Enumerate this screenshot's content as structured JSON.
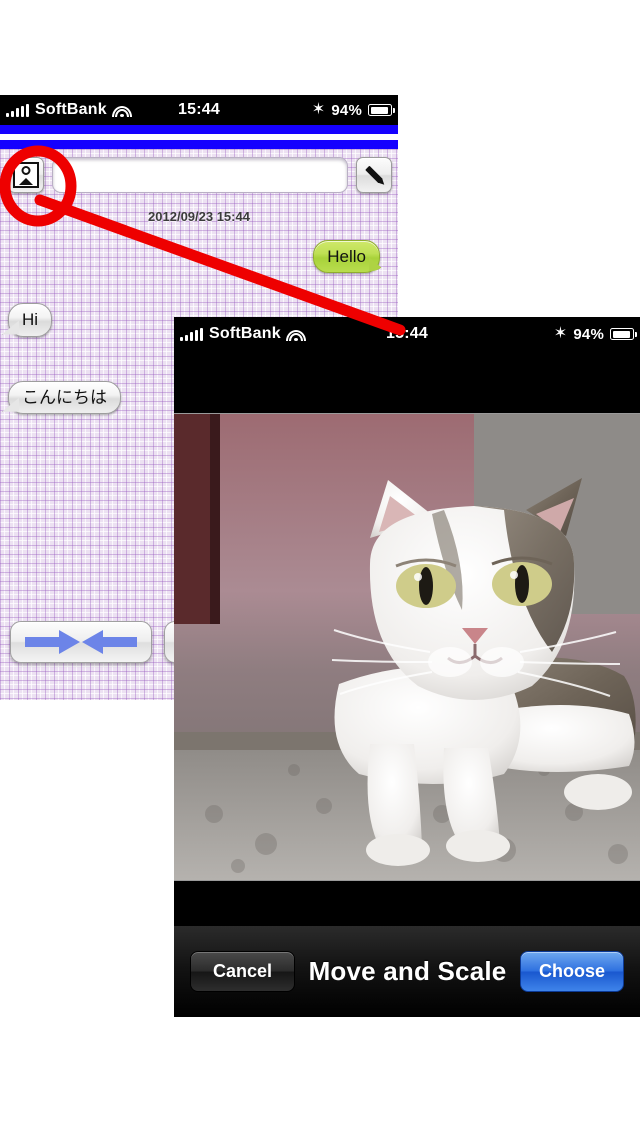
{
  "screen1": {
    "name": "chat-screen",
    "statusbar": {
      "carrier": "SoftBank",
      "time": "15:44",
      "battery_pct": "94%",
      "signal_icon": "signal-bars-icon",
      "wifi_icon": "wifi-icon",
      "bluetooth_icon": "bluetooth-icon",
      "battery_icon": "battery-icon"
    },
    "toolbar": {
      "image_button_icon": "flower-picture-icon",
      "input_value": "",
      "input_placeholder": "",
      "pencil_button_icon": "pencil-icon"
    },
    "datestamp": "2012/09/23 15:44",
    "messages": [
      {
        "text": "Hello",
        "side": "right",
        "style": "green"
      },
      {
        "text": "Hi",
        "side": "left",
        "style": "grey"
      },
      {
        "text": "こんにちは",
        "side": "left",
        "style": "grey"
      }
    ],
    "buttons": [
      {
        "name": "arrow-pair-button",
        "icon": "double-arrow-icon"
      },
      {
        "name": "secondary-button",
        "icon": ""
      }
    ]
  },
  "screen2": {
    "name": "move-and-scale-screen",
    "statusbar": {
      "carrier": "SoftBank",
      "time": "15:44",
      "battery_pct": "94%",
      "signal_icon": "signal-bars-icon",
      "wifi_icon": "wifi-icon",
      "bluetooth_icon": "bluetooth-icon",
      "battery_icon": "battery-icon"
    },
    "photo": {
      "subject": "cat-photo",
      "alt_icon": "photo-preview"
    },
    "toolbar": {
      "cancel_label": "Cancel",
      "title": "Move and Scale",
      "choose_label": "Choose"
    }
  },
  "annotation": {
    "shape": "red-circle-and-arrow",
    "color": "#ee0000",
    "target_icon": "flower-picture-icon"
  },
  "colors": {
    "accent_blue": "#1500ff",
    "choose_blue": "#2f71e0",
    "bubble_green": "#b9dd4e",
    "annotation_red": "#ee0000"
  }
}
